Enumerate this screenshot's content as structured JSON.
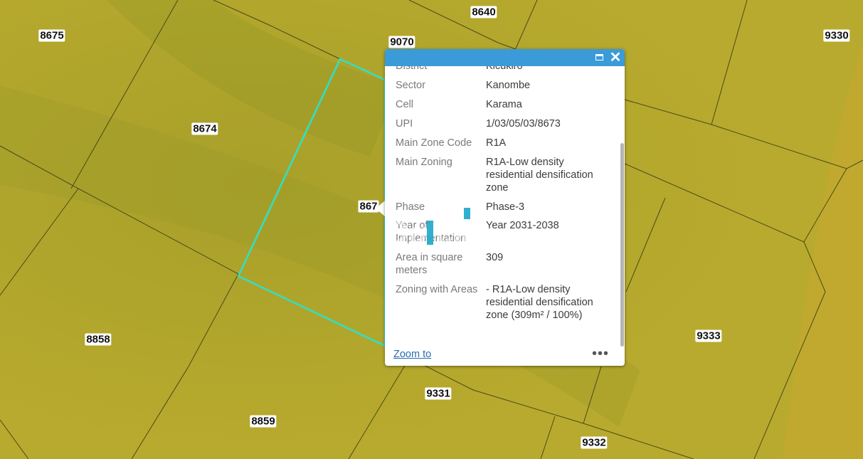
{
  "colors": {
    "selection": "#2fe0c8",
    "header": "#3b9bd8",
    "parcel_line": "#4a4a1a"
  },
  "parcels": [
    "8675",
    "9070",
    "8640",
    "9330",
    "8674",
    "867",
    "8858",
    "9333",
    "9331",
    "8859",
    "9332"
  ],
  "popup": {
    "fields": [
      {
        "name": "District",
        "value": "Kicukiro"
      },
      {
        "name": "Sector",
        "value": "Kanombe"
      },
      {
        "name": "Cell",
        "value": "Karama"
      },
      {
        "name": "UPI",
        "value": "1/03/05/03/8673"
      },
      {
        "name": "Main Zone Code",
        "value": "R1A"
      },
      {
        "name": "Main Zoning",
        "value": "R1A-Low density residential densification zone"
      },
      {
        "name": "Phase",
        "value": "Phase-3"
      },
      {
        "name": "Year of Implementation",
        "value": "Year 2031-2038"
      },
      {
        "name": "Area in square meters",
        "value": "309"
      },
      {
        "name": "Zoning with Areas",
        "value": "- R1A-Low density residential densification zone (309m² / 100%)"
      }
    ],
    "zoom_label": "Zoom to",
    "more_label": "•••",
    "close_label": "✕",
    "maximize_icon": "maximize-icon",
    "watermark": "Quick"
  }
}
